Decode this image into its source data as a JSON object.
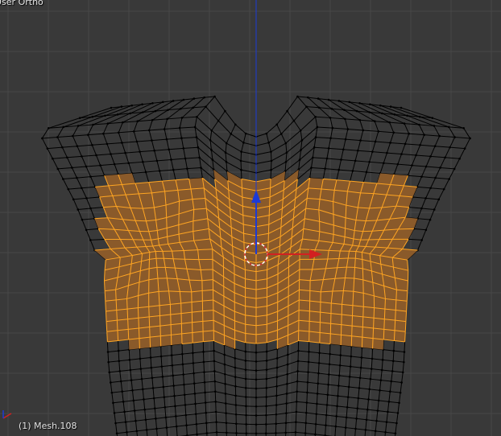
{
  "viewport": {
    "view_label": "User Ortho",
    "object_label": "(1) Mesh.108",
    "colors": {
      "background": "#393939",
      "grid": "#474747",
      "wire": "#000000",
      "selected_face": "#8a5a2a",
      "selected_wire": "#ffa522",
      "axis_x": "#d22020",
      "axis_y": "#8fcc2e",
      "axis_z": "#1c3ad6",
      "cursor": "#ffffff"
    }
  },
  "icons": {
    "cursor": "3d-cursor-icon",
    "gizmo": "transform-manipulator-icon",
    "axes": "axis-widget-icon"
  }
}
